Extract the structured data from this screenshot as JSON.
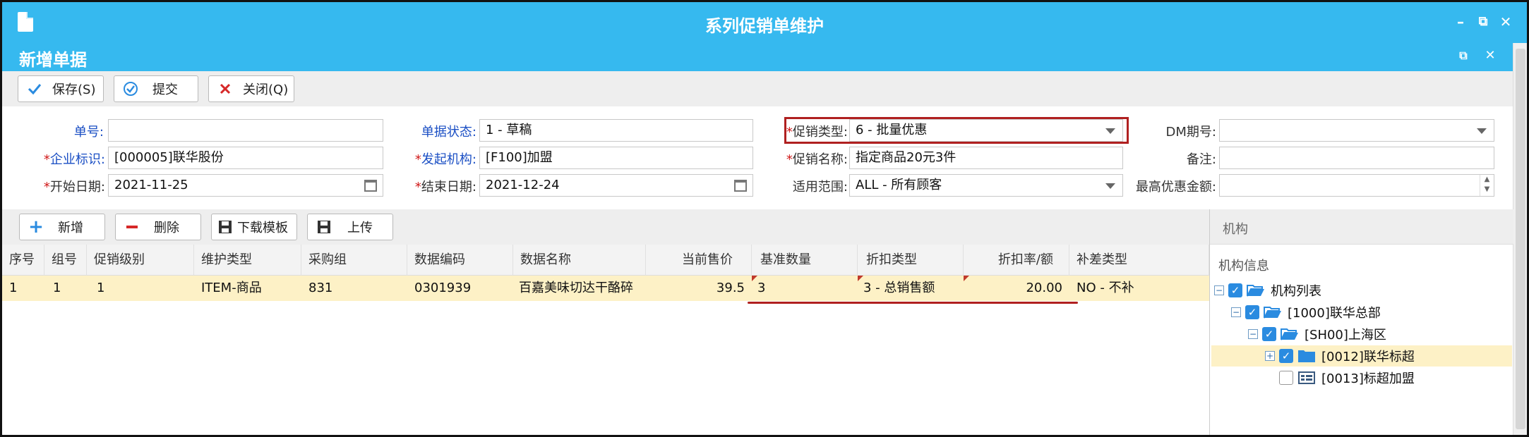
{
  "window": {
    "title": "系列促销单维护",
    "subtitle": "新增单据"
  },
  "toolbar": {
    "save_label": "保存(S)",
    "submit_label": "提交",
    "close_label": "关闭(Q)"
  },
  "form": {
    "doc_no_label": "单号:",
    "doc_no_value": "",
    "status_label": "单据状态:",
    "status_value": "1 - 草稿",
    "promo_type_label": "促销类型:",
    "promo_type_value": "6 - 批量优惠",
    "dm_label": "DM期号:",
    "dm_value": "",
    "company_label": "企业标识:",
    "company_value": "[000005]联华股份",
    "org_label": "发起机构:",
    "org_value": "[F100]加盟",
    "promo_name_label": "促销名称:",
    "promo_name_value": "指定商品20元3件",
    "remark_label": "备注:",
    "remark_value": "",
    "start_label": "开始日期:",
    "start_value": "2021-11-25",
    "end_label": "结束日期:",
    "end_value": "2021-12-24",
    "scope_label": "适用范围:",
    "scope_value": "ALL - 所有顾客",
    "max_discount_label": "最高优惠金额:",
    "max_discount_value": ""
  },
  "grid_toolbar": {
    "add_label": "新增",
    "delete_label": "删除",
    "download_label": "下载模板",
    "upload_label": "上传"
  },
  "grid": {
    "headers": [
      "序号",
      "组号",
      "促销级别",
      "维护类型",
      "采购组",
      "数据编码",
      "数据名称",
      "当前售价",
      "基准数量",
      "折扣类型",
      "折扣率/额",
      "补差类型"
    ],
    "rows": [
      [
        "1",
        "1",
        "1",
        "ITEM-商品",
        "831",
        "0301939",
        "百嘉美味切达干酪碎",
        "39.5",
        "3",
        "3 - 总销售额",
        "20.00",
        "NO - 不补"
      ]
    ]
  },
  "panel": {
    "title": "机构",
    "subtitle": "机构信息",
    "tree": [
      "机构列表",
      "[1000]联华总部",
      "[SH00]上海区",
      "[0012]联华标超",
      "[0013]标超加盟"
    ]
  },
  "colors": {
    "titlebar": "#36b9ef",
    "required": "#d01818",
    "label_blue": "#1b4fc4",
    "selected_row": "#fdf1c6",
    "highlight": "#b02020"
  }
}
